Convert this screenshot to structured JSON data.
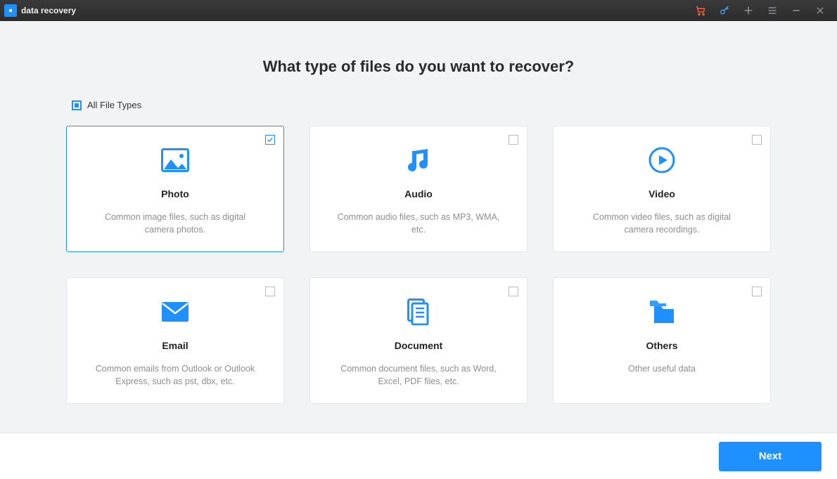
{
  "app": {
    "title": "data recovery"
  },
  "titlebar_icons": {
    "cart": "cart-icon",
    "key": "key-icon",
    "plus": "plus-icon",
    "menu": "menu-icon",
    "min": "minimize-icon",
    "close": "close-icon"
  },
  "page": {
    "heading": "What type of files do you want to recover?",
    "all_files_label": "All File Types"
  },
  "cards": [
    {
      "id": "photo",
      "title": "Photo",
      "desc": "Common image files, such as digital camera photos.",
      "checked": true
    },
    {
      "id": "audio",
      "title": "Audio",
      "desc": "Common audio files, such as MP3, WMA, etc.",
      "checked": false
    },
    {
      "id": "video",
      "title": "Video",
      "desc": "Common video files, such as digital camera recordings.",
      "checked": false
    },
    {
      "id": "email",
      "title": "Email",
      "desc": "Common emails from Outlook or Outlook Express, such as pst, dbx, etc.",
      "checked": false
    },
    {
      "id": "document",
      "title": "Document",
      "desc": "Common document files, such as Word, Excel, PDF files, etc.",
      "checked": false
    },
    {
      "id": "others",
      "title": "Others",
      "desc": "Other useful data",
      "checked": false
    }
  ],
  "footer": {
    "next_label": "Next"
  },
  "colors": {
    "accent": "#1e90ff"
  }
}
